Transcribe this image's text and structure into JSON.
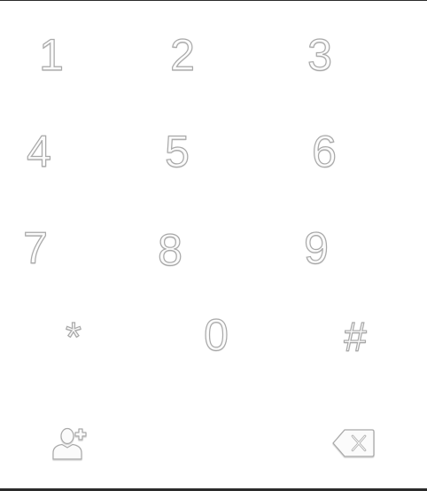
{
  "dialpad": {
    "keys": [
      {
        "label": "1"
      },
      {
        "label": "2"
      },
      {
        "label": "3"
      },
      {
        "label": "4"
      },
      {
        "label": "5"
      },
      {
        "label": "6"
      },
      {
        "label": "7"
      },
      {
        "label": "8"
      },
      {
        "label": "9"
      },
      {
        "label": "*"
      },
      {
        "label": "0"
      },
      {
        "label": "#"
      }
    ]
  },
  "actions": {
    "add_contact_icon": "add-contact-icon",
    "backspace_icon": "backspace-icon"
  },
  "colors": {
    "key_fill": "#fbfbfb",
    "key_stroke": "#a9a9a9",
    "border": "#2b2b2b",
    "background": "#ffffff"
  }
}
